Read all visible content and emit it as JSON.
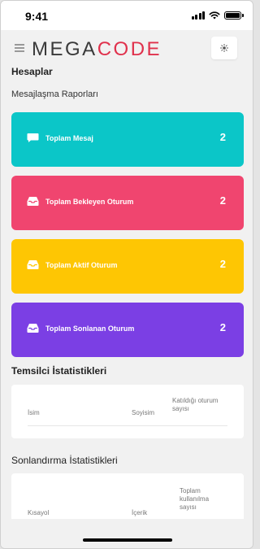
{
  "status": {
    "time": "9:41"
  },
  "header": {
    "logo_part1": "MEGA",
    "logo_part2": "CODE"
  },
  "page": {
    "title": "Hesaplar",
    "subtitle": "Mesajlaşma Raporları"
  },
  "cards": [
    {
      "label": "Toplam Mesaj",
      "value": "2",
      "color": "#0bc6c8",
      "icon": "message-icon"
    },
    {
      "label": "Toplam Bekleyen Oturum",
      "value": "2",
      "color": "#f0456f",
      "icon": "inbox-icon"
    },
    {
      "label": "Toplam Aktif Oturum",
      "value": "2",
      "color": "#fec603",
      "icon": "inbox-icon"
    },
    {
      "label": "Toplam Sonlanan Oturum",
      "value": "2",
      "color": "#7b3fe4",
      "icon": "inbox-icon"
    }
  ],
  "rep_stats": {
    "title": "Temsilci İstatistikleri",
    "columns": [
      "İsim",
      "Soyisim",
      "Katıldığı oturum sayısı"
    ]
  },
  "end_stats": {
    "title": "Sonlandırma İstatistikleri",
    "columns": [
      "Kısayol",
      "İçerik",
      "Toplam kullanılma sayısı"
    ]
  }
}
